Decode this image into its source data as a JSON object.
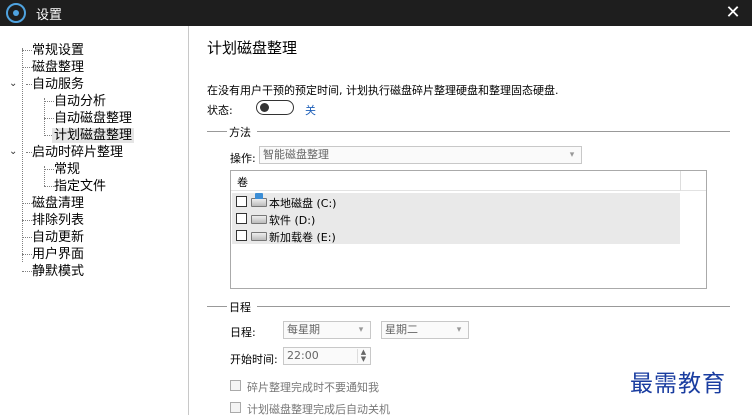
{
  "window": {
    "title": "设置",
    "close_glyph": "✕"
  },
  "sidebar": {
    "items": [
      {
        "label": "常规设置"
      },
      {
        "label": "磁盘整理"
      },
      {
        "label": "自动服务"
      },
      {
        "label": "自动分析"
      },
      {
        "label": "自动磁盘整理"
      },
      {
        "label": "计划磁盘整理"
      },
      {
        "label": "启动时碎片整理"
      },
      {
        "label": "常规"
      },
      {
        "label": "指定文件"
      },
      {
        "label": "磁盘清理"
      },
      {
        "label": "排除列表"
      },
      {
        "label": "自动更新"
      },
      {
        "label": "用户界面"
      },
      {
        "label": "静默模式"
      }
    ],
    "selected": "计划磁盘整理"
  },
  "main": {
    "title": "计划磁盘整理",
    "description": "在没有用户干预的预定时间, 计划执行磁盘碎片整理硬盘和整理固态硬盘.",
    "status_label": "状态:",
    "status_value": "关",
    "method": {
      "section_label": "方法",
      "operation_label": "操作:",
      "operation_value": "智能磁盘整理",
      "volumes_header": "卷",
      "volumes": [
        {
          "label": "本地磁盘 (C:)",
          "icon": "system-drive-icon"
        },
        {
          "label": "软件 (D:)",
          "icon": "drive-icon"
        },
        {
          "label": "新加载卷 (E:)",
          "icon": "drive-icon"
        }
      ]
    },
    "schedule": {
      "section_label": "日程",
      "schedule_label": "日程:",
      "frequency_value": "每星期",
      "day_value": "星期二",
      "start_time_label": "开始时间:",
      "start_time_value": "22:00",
      "options": [
        {
          "label": "碎片整理完成时不要通知我"
        },
        {
          "label": "计划磁盘整理完成后自动关机"
        }
      ]
    }
  },
  "watermark": "最需教育",
  "colors": {
    "titlebar": "#1e1e1e",
    "accent": "#1e5fb8",
    "watermark": "#1a3da0"
  }
}
